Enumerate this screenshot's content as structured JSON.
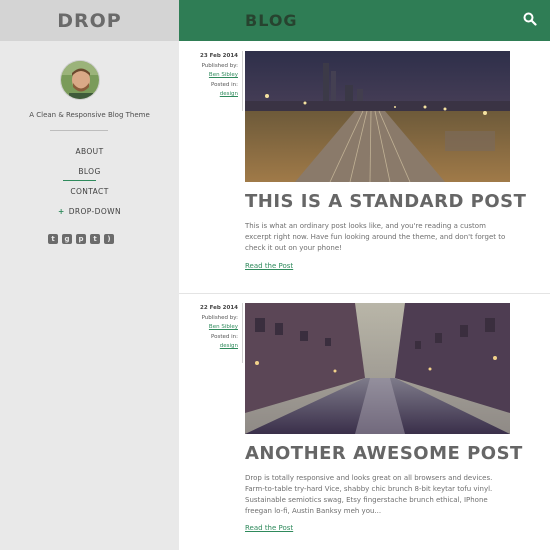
{
  "site": {
    "logo": "DROP",
    "tagline": "A Clean & Responsive Blog Theme"
  },
  "nav": {
    "items": [
      {
        "label": "ABOUT"
      },
      {
        "label": "BLOG"
      },
      {
        "label": "CONTACT"
      },
      {
        "label": "DROP-DOWN",
        "prefix": "+"
      }
    ]
  },
  "social": {
    "icons": [
      "twitter-icon",
      "google-plus-icon",
      "pinterest-icon",
      "tumblr-icon",
      "rss-icon"
    ]
  },
  "header": {
    "title": "BLOG",
    "search_icon": "search-icon"
  },
  "posts": [
    {
      "date": "23 Feb 2014",
      "published_label": "Published by:",
      "author": "Ben Sibley",
      "posted_label": "Posted in:",
      "category": "design",
      "title": "THIS IS A STANDARD POST",
      "excerpt": "This is what an ordinary post looks like, and you're reading a custom excerpt right now. Have fun looking around the theme, and don't forget to check it out on your phone!",
      "read_more": "Read the Post"
    },
    {
      "date": "22 Feb 2014",
      "published_label": "Published by:",
      "author": "Ben Sibley",
      "posted_label": "Posted in:",
      "category": "design",
      "title": "ANOTHER AWESOME POST",
      "excerpt": "Drop is totally responsive and looks great on all browsers and devices. Farm-to-table try-hard Vice, shabby chic brunch 8-bit keytar tofu vinyl. Sustainable semiotics swag, Etsy fingerstache brunch ethical, IPhone freegan lo-fi, Austin Banksy meh you...",
      "read_more": "Read the Post"
    }
  ],
  "colors": {
    "accent": "#2f7d55",
    "sidebar": "#e9e9e9",
    "logo_bar": "#d4d4d4"
  }
}
